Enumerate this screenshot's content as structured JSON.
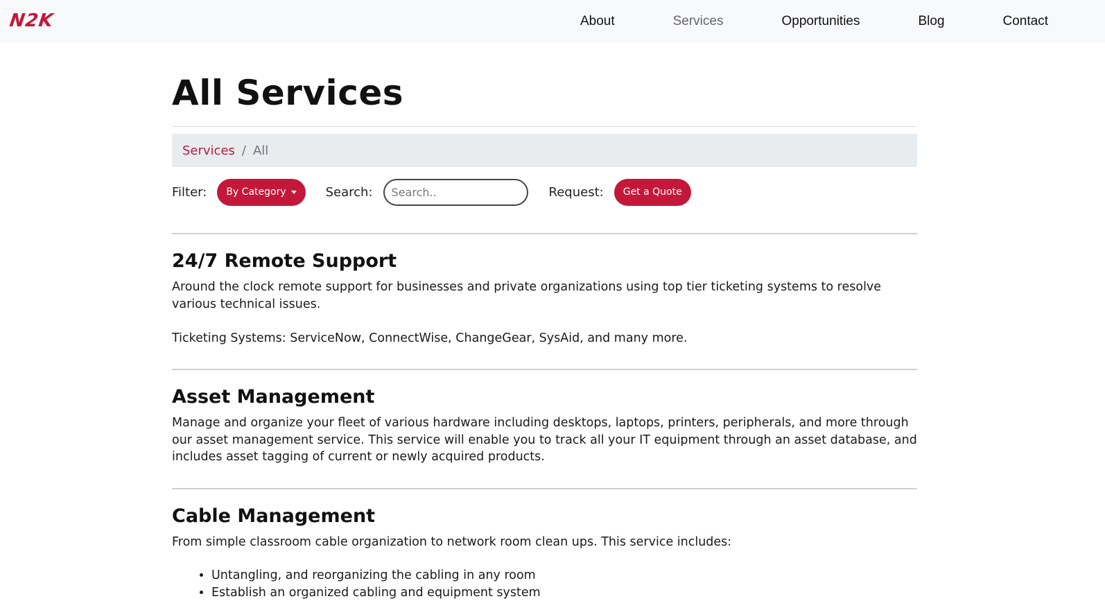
{
  "brand": {
    "logo_text": "N2K",
    "logo_color": "#c3183a"
  },
  "nav": {
    "links": [
      "About",
      "Services",
      "Opportunities",
      "Blog",
      "Contact"
    ],
    "active": "Services"
  },
  "page": {
    "title": "All Services"
  },
  "breadcrumb": {
    "link": "Services",
    "separator": "/",
    "current": "All"
  },
  "toolbar": {
    "filter_label": "Filter:",
    "filter_button": "By Category",
    "search_label": "Search:",
    "search_placeholder": "Search..",
    "request_label": "Request:",
    "quote_button": "Get a Quote"
  },
  "services": [
    {
      "title": "24/7 Remote Support",
      "paragraphs": [
        "Around the clock remote support for businesses and private organizations using top tier ticketing systems to resolve various technical issues.",
        "Ticketing Systems: ServiceNow, ConnectWise, ChangeGear, SysAid, and many more."
      ]
    },
    {
      "title": "Asset Management",
      "paragraphs": [
        "Manage and organize your fleet of various hardware including desktops, laptops, printers, peripherals, and more through our asset management service. This service will enable you to track all your IT equipment through an asset database, and includes asset tagging of current or newly acquired products."
      ]
    },
    {
      "title": "Cable Management",
      "paragraphs": [
        "From simple classroom cable organization to network room clean ups. This service includes:"
      ],
      "bullets": [
        "Untangling, and reorganizing the cabling in any room",
        "Establish an organized cabling and equipment system"
      ]
    }
  ],
  "colors": {
    "accent": "#c3183a",
    "navbar_bg": "#f8f9fa",
    "breadcrumb_bg": "#e9ecef"
  }
}
